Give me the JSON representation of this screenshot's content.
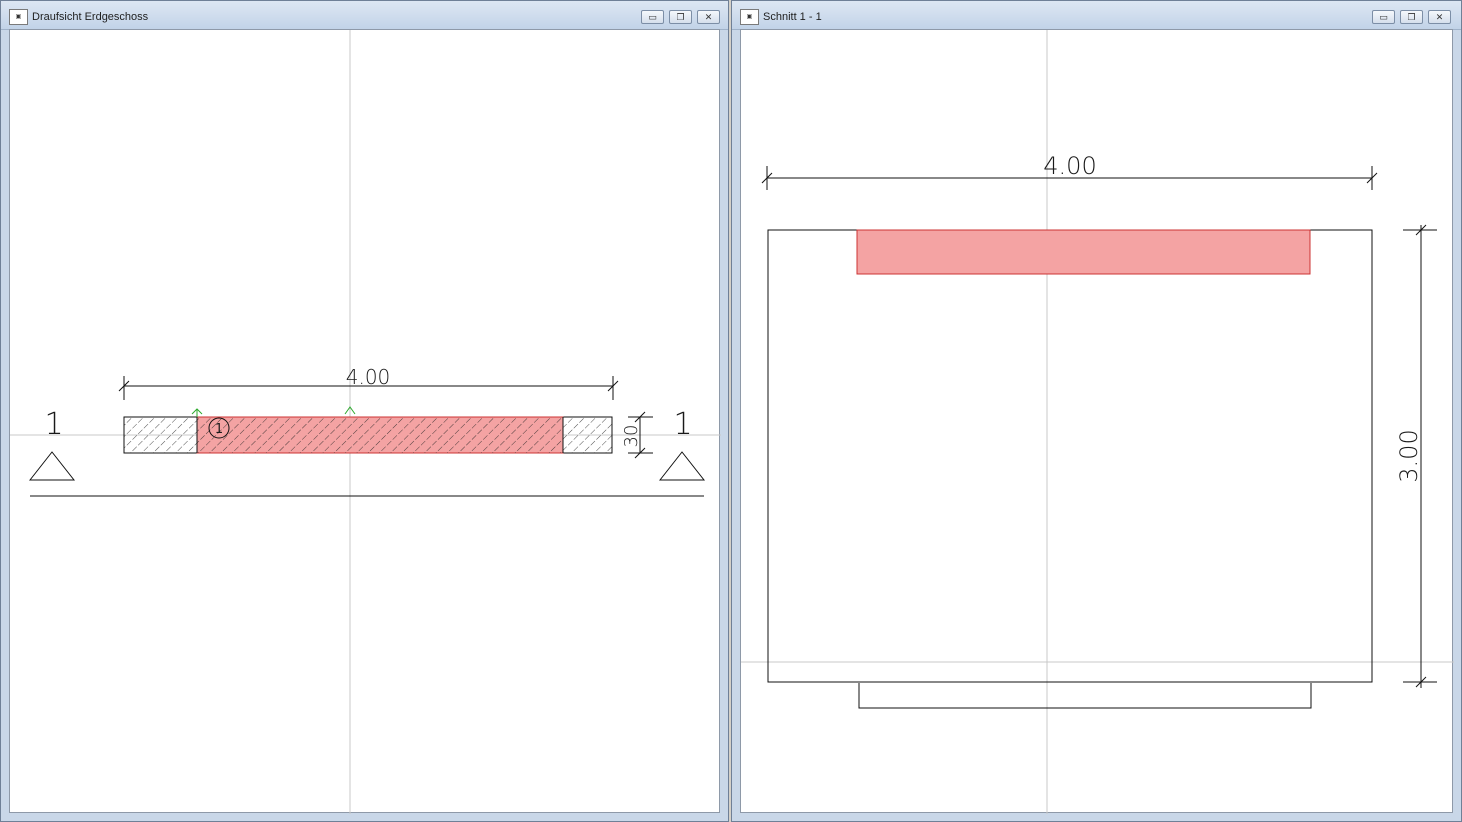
{
  "left_window": {
    "title": "Draufsicht Erdgeschoss",
    "app_icon": "app-icon",
    "controls": {
      "minimize": "▭",
      "restore": "❐",
      "close": "✕"
    },
    "drawing": {
      "dimension_length": "4.00",
      "dimension_thickness": "30",
      "section_mark_left": "1",
      "section_mark_right": "1",
      "element_number": "1",
      "highlight_color": "#f4a3a3"
    }
  },
  "right_window": {
    "title": "Schnitt 1 - 1",
    "app_icon": "app-icon",
    "controls": {
      "minimize": "▭",
      "restore": "❐",
      "close": "✕"
    },
    "drawing": {
      "dimension_width": "4.00",
      "dimension_height": "3.00",
      "highlight_color": "#f4a3a3"
    }
  }
}
